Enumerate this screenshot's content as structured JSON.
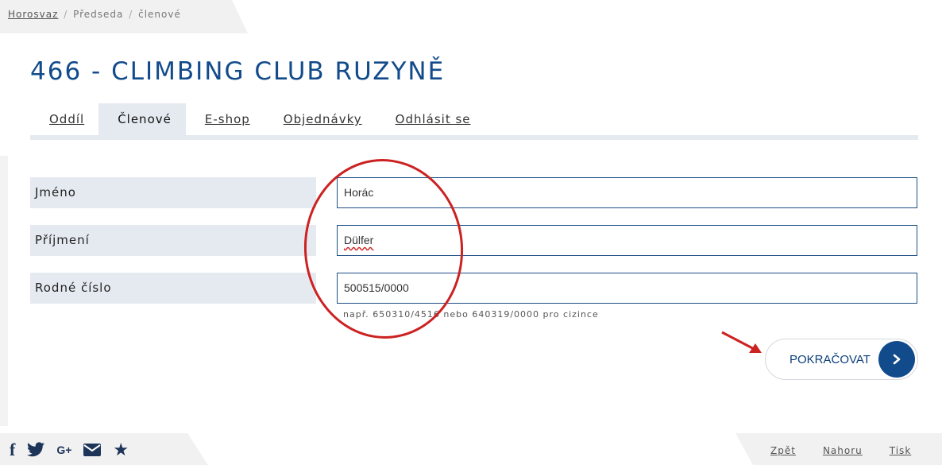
{
  "breadcrumb": {
    "home": "Horosvaz",
    "sep": "/",
    "level1": "Předseda",
    "level2": "členové"
  },
  "page": {
    "title": "466 - CLIMBING CLUB RUZYNĚ"
  },
  "tabs": [
    {
      "label": "Oddíl",
      "active": false
    },
    {
      "label": "Členové",
      "active": true
    },
    {
      "label": "E-shop",
      "active": false
    },
    {
      "label": "Objednávky",
      "active": false
    },
    {
      "label": "Odhlásit se",
      "active": false
    }
  ],
  "form": {
    "fields": [
      {
        "label": "Jméno",
        "value": "Horác"
      },
      {
        "label": "Příjmení",
        "value": "Dülfer"
      },
      {
        "label": "Rodné číslo",
        "value": "500515/0000"
      }
    ],
    "hint": "např. 650310/4516 nebo 640319/0000 pro cizince",
    "continue_label": "POKRAČOVAT"
  },
  "footer": {
    "social_icons": [
      "facebook-icon",
      "twitter-icon",
      "google-plus-icon",
      "mail-icon",
      "star-icon"
    ],
    "google_plus_text": "G+",
    "links": [
      "Zpět",
      "Nahoru",
      "Tisk"
    ]
  },
  "colors": {
    "brand_blue": "#124b8b",
    "annotation_red": "#cc2222",
    "label_bg": "#e5eaf1"
  }
}
